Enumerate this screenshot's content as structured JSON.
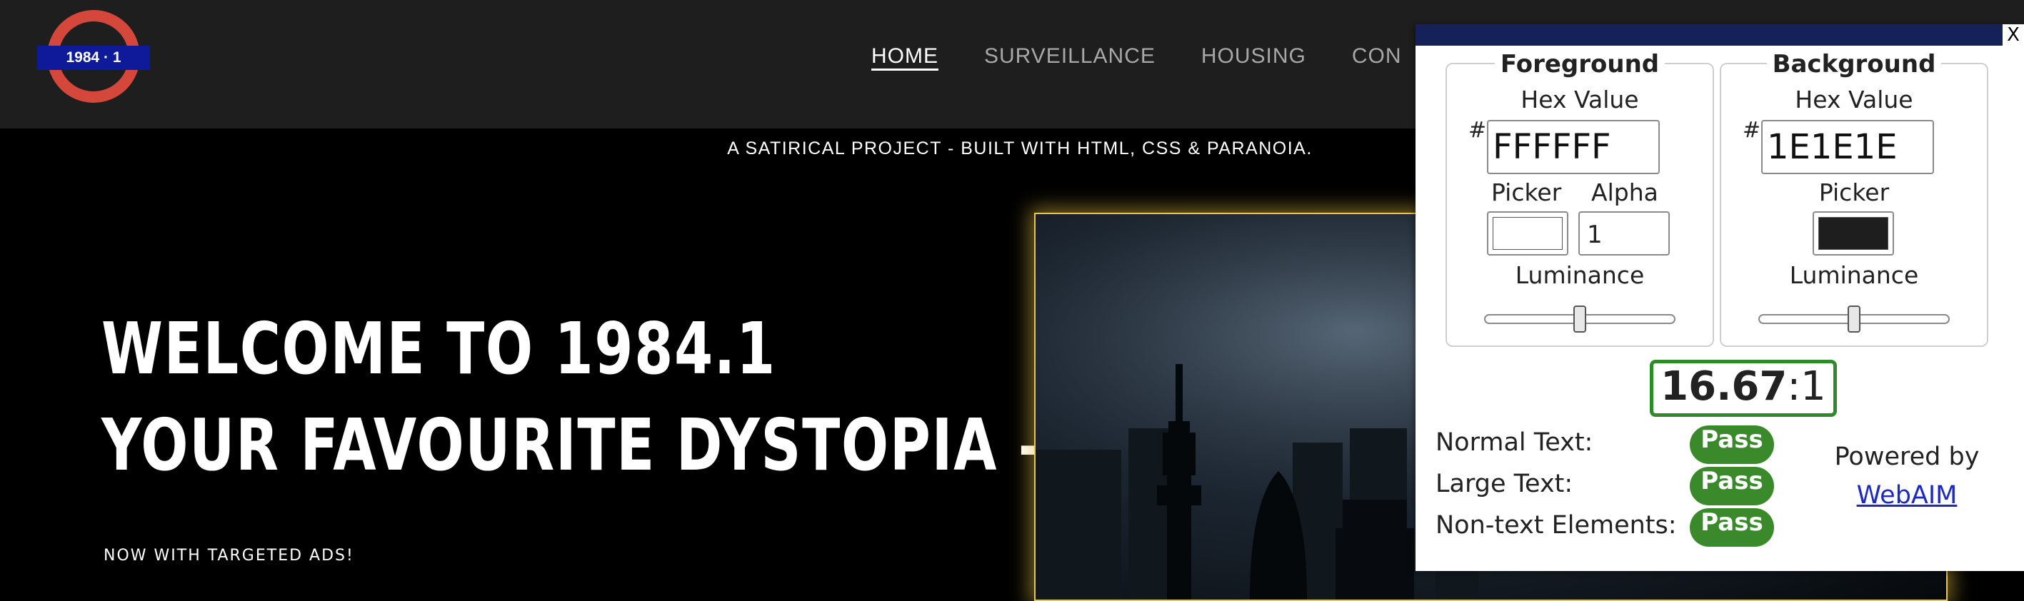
{
  "site": {
    "logo_text": "1984 · 1",
    "tagline": "A SATIRICAL PROJECT - BUILT WITH HTML, CSS & PARANOIA.",
    "nav": [
      {
        "label": "HOME",
        "active": true
      },
      {
        "label": "SURVEILLANCE",
        "active": false
      },
      {
        "label": "HOUSING",
        "active": false
      },
      {
        "label": "CON",
        "active": false
      }
    ],
    "hero": {
      "line1": "WELCOME TO 1984.1",
      "line2": "YOUR FAVOURITE DYSTOPIA —",
      "subtitle": "NOW WITH TARGETED ADS!",
      "image_alt": "city skyline at night"
    },
    "colors": {
      "header_bg": "#1e1e1e",
      "page_bg": "#000000",
      "accent_frame": "#e6c94c"
    }
  },
  "checker": {
    "close_label": "X",
    "foreground": {
      "legend": "Foreground",
      "hex_label": "Hex Value",
      "hash": "#",
      "hex_value": "FFFFFF",
      "picker_label": "Picker",
      "picker_color": "#ffffff",
      "alpha_label": "Alpha",
      "alpha_value": "1",
      "luminance_label": "Luminance",
      "luminance_level": 0.5
    },
    "background": {
      "legend": "Background",
      "hex_label": "Hex Value",
      "hash": "#",
      "hex_value": "1E1E1E",
      "picker_label": "Picker",
      "picker_color": "#1e1e1e",
      "luminance_label": "Luminance",
      "luminance_level": 0.5
    },
    "ratio_value": "16.67",
    "ratio_suffix": ":1",
    "results": [
      {
        "label": "Normal Text:",
        "status": "Pass"
      },
      {
        "label": "Large Text:",
        "status": "Pass"
      },
      {
        "label": "Non-text Elements:",
        "status": "Pass"
      }
    ],
    "powered_by": "Powered by",
    "link_text": "WebAIM",
    "colors": {
      "pass_green": "#3a8a2c",
      "topbar": "#142259",
      "link": "#1c2bbf"
    }
  }
}
